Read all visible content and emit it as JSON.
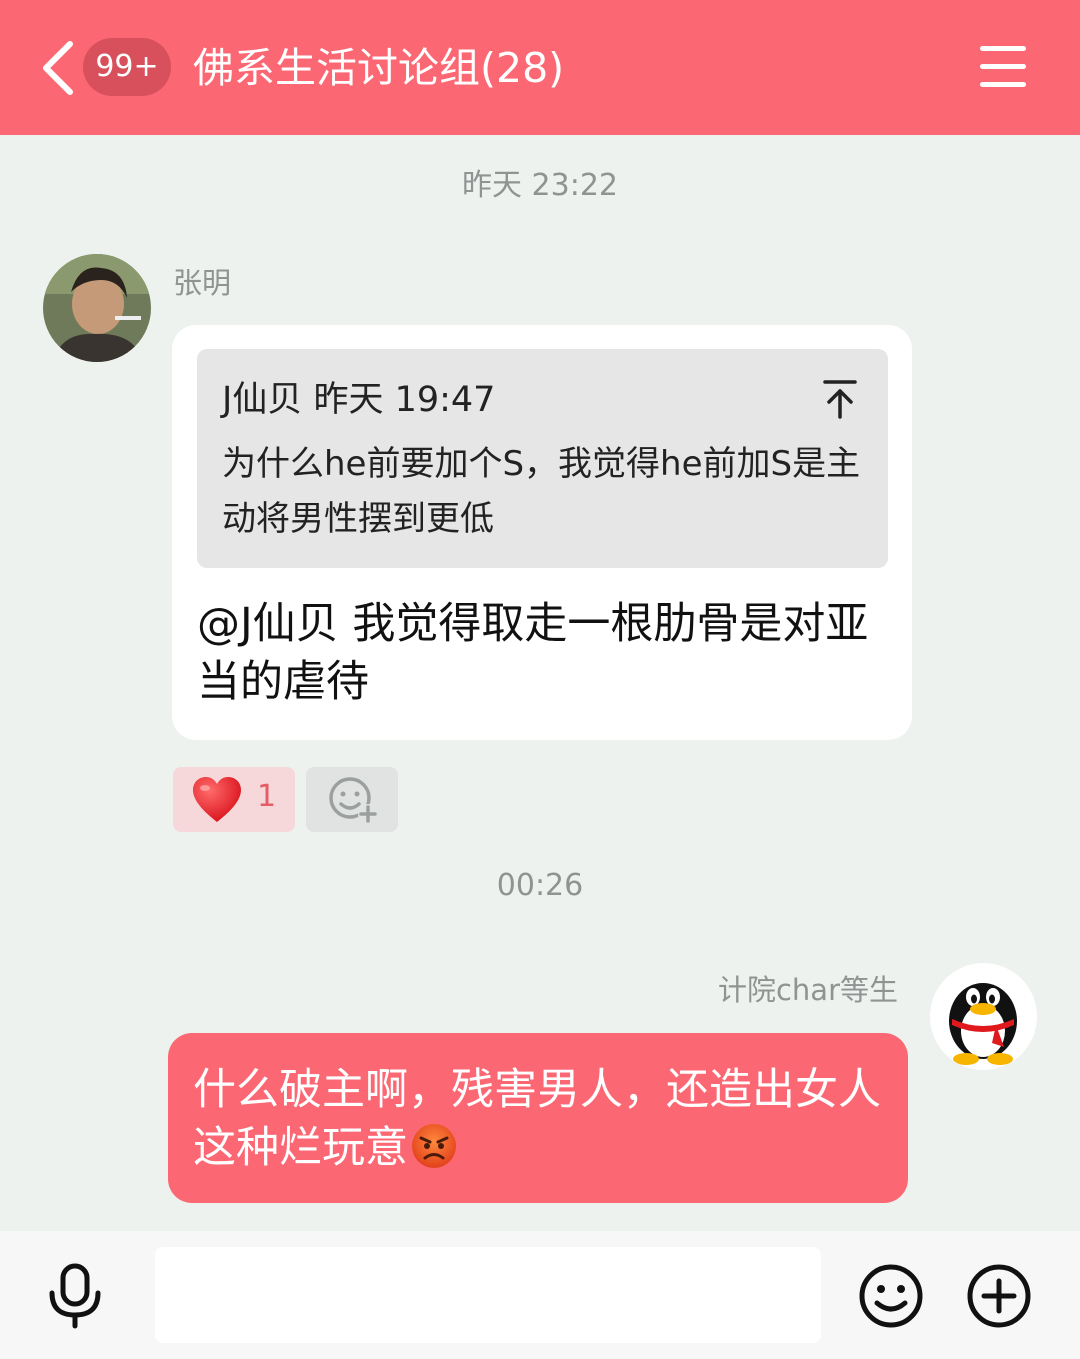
{
  "header": {
    "back_label": "",
    "unread_badge": "99+",
    "title": "佛系生活讨论组(28)",
    "menu_icon": "menu-icon"
  },
  "timestamps": {
    "first": "昨天 23:22",
    "second": "00:26"
  },
  "messages": [
    {
      "sender": "张明",
      "quote": {
        "author_time": "J仙贝 昨天 19:47",
        "text": "为什么he前要加个S，我觉得he前加S是主动将男性摆到更低"
      },
      "text": "@J仙贝 我觉得取走一根肋骨是对亚当的虐待",
      "reactions": [
        {
          "icon": "heart-icon",
          "count": "1"
        },
        {
          "icon": "add-emoji-icon",
          "count": ""
        }
      ]
    },
    {
      "sender": "计院char等生",
      "text": "什么破主啊，残害男人，还造出女人这种烂玩意",
      "emoji": "angry-face-icon"
    }
  ],
  "composer": {
    "placeholder": "",
    "voice_icon": "microphone-icon",
    "emoji_icon": "smiley-icon",
    "plus_icon": "plus-icon"
  },
  "colors": {
    "accent": "#fb6874",
    "background": "#eef2ef"
  }
}
